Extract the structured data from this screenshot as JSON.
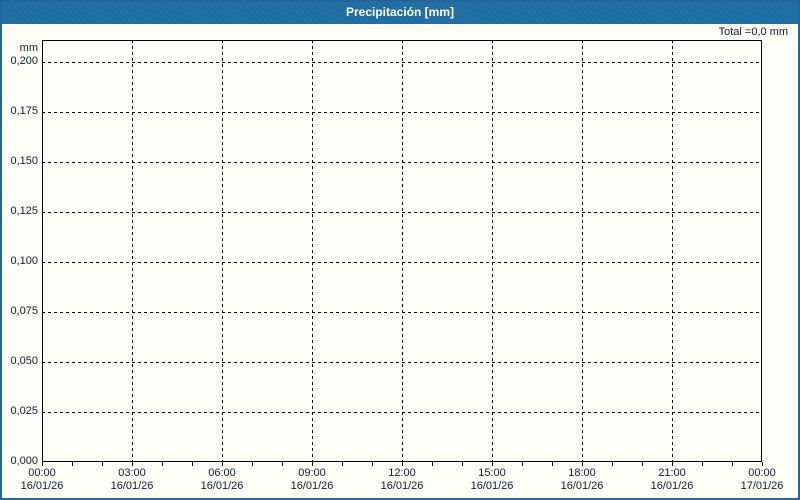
{
  "header": {
    "title": "Precipitación [mm]"
  },
  "chart_data": {
    "type": "bar",
    "title": "Precipitación [mm]",
    "annotation_total": "Total =0,0 mm",
    "ylabel": "mm",
    "xlabel": "",
    "ylim": [
      0,
      0.211
    ],
    "grid": true,
    "legend": "none",
    "y_tick_values": [
      0.2,
      0.175,
      0.15,
      0.125,
      0.1,
      0.075,
      0.05,
      0.025,
      0.0
    ],
    "y_tick_labels": [
      "0,200",
      "0,175",
      "0,150",
      "0,125",
      "0,100",
      "0,075",
      "0,050",
      "0,025",
      "0,000"
    ],
    "hours_span": 24,
    "x_tick_hours": [
      0,
      3,
      6,
      9,
      12,
      15,
      18,
      21,
      24
    ],
    "x_tick_times": [
      "00:00",
      "03:00",
      "06:00",
      "09:00",
      "12:00",
      "15:00",
      "18:00",
      "21:00",
      "00:00"
    ],
    "x_tick_dates": [
      "16/01/26",
      "16/01/26",
      "16/01/26",
      "16/01/26",
      "16/01/26",
      "16/01/26",
      "16/01/26",
      "16/01/26",
      "17/01/26"
    ],
    "x_grid_hours": [
      3,
      6,
      9,
      12,
      15,
      18,
      21
    ],
    "minor_tick_every_hours": 1,
    "series": [
      {
        "name": "Precipitación",
        "unit": "mm",
        "values": [],
        "total_mm": "0,0"
      }
    ]
  },
  "colors": {
    "titlebar": "#1e6ca0",
    "frame_border": "#22669e",
    "background": "#fcfdf4",
    "grid": "#000000",
    "text": "#0f1c33",
    "title_text": "#ffffff"
  }
}
